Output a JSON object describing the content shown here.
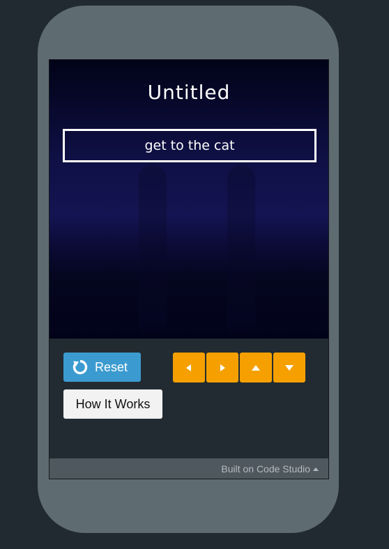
{
  "app": {
    "title": "Untitled",
    "goal_text": "get to the cat"
  },
  "controls": {
    "reset_label": "Reset",
    "how_it_works_label": "How It Works",
    "arrows": [
      "left-arrow-icon",
      "right-arrow-icon",
      "up-arrow-icon",
      "down-arrow-icon"
    ]
  },
  "footer": {
    "label": "Built on Code Studio"
  },
  "colors": {
    "reset_button": "#3b9bd0",
    "arrow_button": "#f5a000",
    "how_button": "#f2f2f2",
    "phone_frame": "#5e6b71",
    "background": "#212a31"
  }
}
